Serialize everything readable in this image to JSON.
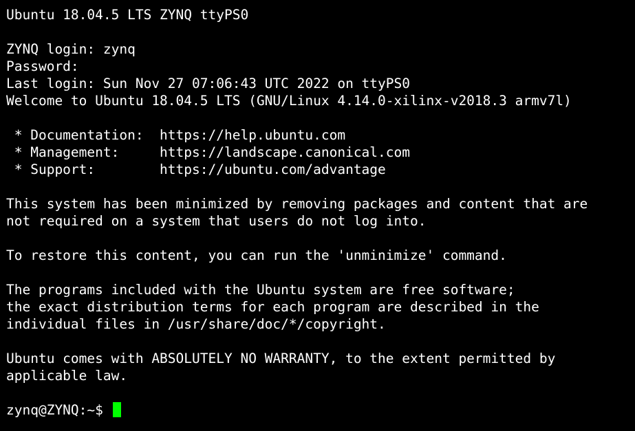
{
  "colors": {
    "background": "#000000",
    "text": "#ffffff",
    "cursor": "#00ff00"
  },
  "terminal": {
    "lines": [
      "Ubuntu 18.04.5 LTS ZYNQ ttyPS0",
      "",
      "ZYNQ login: zynq",
      "Password:",
      "Last login: Sun Nov 27 07:06:43 UTC 2022 on ttyPS0",
      "Welcome to Ubuntu 18.04.5 LTS (GNU/Linux 4.14.0-xilinx-v2018.3 armv7l)",
      "",
      " * Documentation:  https://help.ubuntu.com",
      " * Management:     https://landscape.canonical.com",
      " * Support:        https://ubuntu.com/advantage",
      "",
      "This system has been minimized by removing packages and content that are",
      "not required on a system that users do not log into.",
      "",
      "To restore this content, you can run the 'unminimize' command.",
      "",
      "The programs included with the Ubuntu system are free software;",
      "the exact distribution terms for each program are described in the",
      "individual files in /usr/share/doc/*/copyright.",
      "",
      "Ubuntu comes with ABSOLUTELY NO WARRANTY, to the extent permitted by",
      "applicable law.",
      ""
    ],
    "prompt": "zynq@ZYNQ:~$ "
  }
}
